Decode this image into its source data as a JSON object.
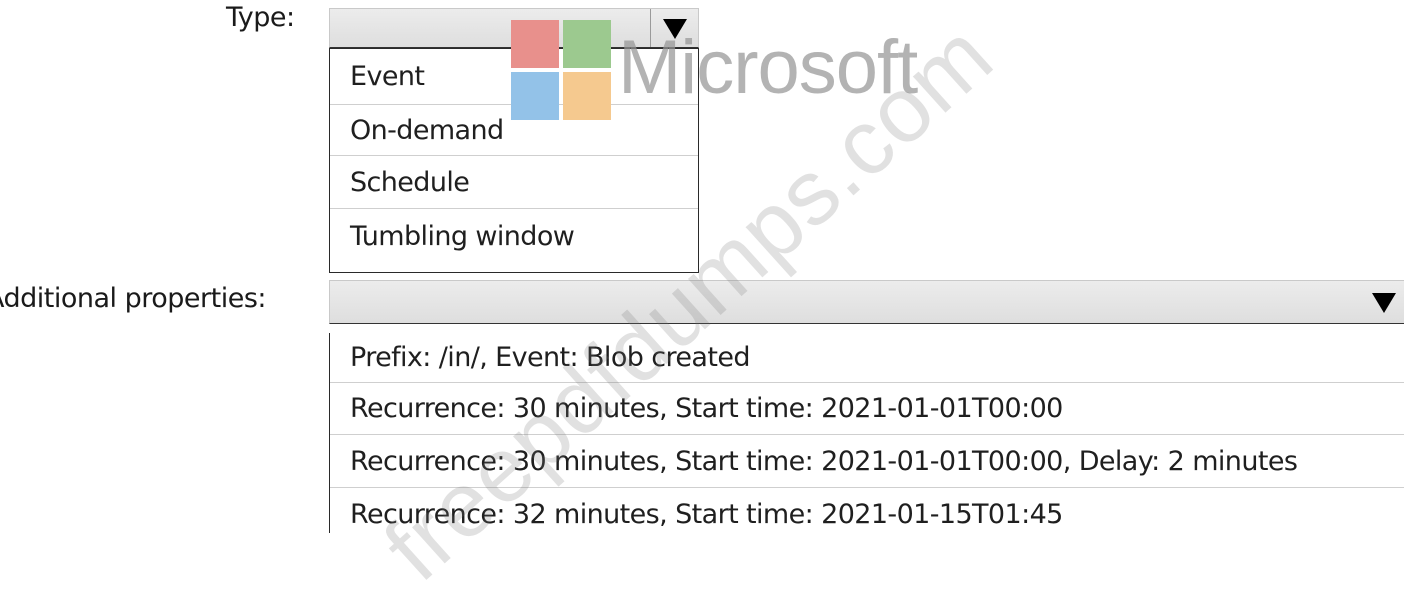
{
  "type_field": {
    "label": "Type:",
    "selected_value": "",
    "options": [
      "Event",
      "On-demand",
      "Schedule",
      "Tumbling window"
    ]
  },
  "additional_properties_field": {
    "label": "Additional properties:",
    "selected_value": "",
    "options": [
      "Prefix: /in/, Event: Blob created",
      "Recurrence: 30 minutes, Start time: 2021-01-01T00:00",
      "Recurrence: 30 minutes, Start time: 2021-01-01T00:00, Delay: 2 minutes",
      "Recurrence: 32 minutes, Start time: 2021-01-15T01:45"
    ]
  },
  "icons": {
    "dropdown_arrow": "triangle-down-icon"
  },
  "watermark": {
    "brand_text": "Microsoft",
    "site_text": "freepdfdumps.com",
    "tile_colors": [
      "#e8908c",
      "#9cc98f",
      "#93c2e8",
      "#f5c98f"
    ]
  }
}
